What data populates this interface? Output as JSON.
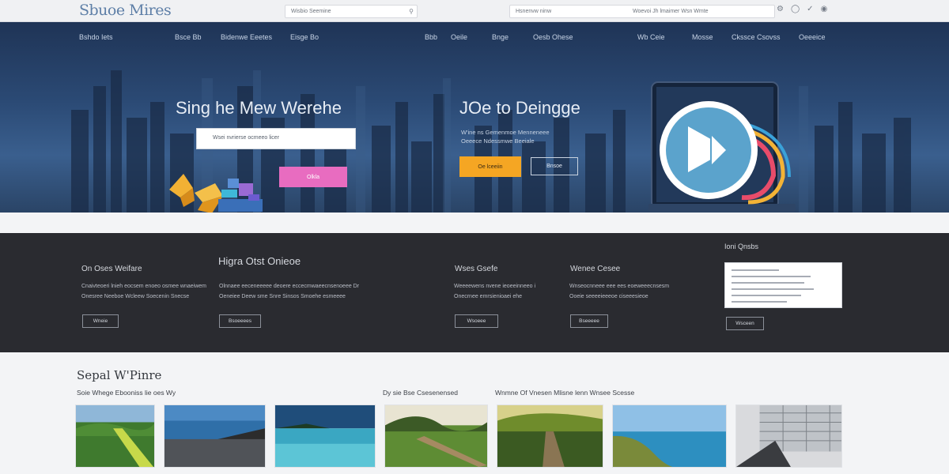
{
  "header": {
    "logo": "Sbuoe Mires",
    "search_left": {
      "placeholder": "Wisbio Seemine"
    },
    "search_right": {
      "placeholder_left": "Hsnenvw ninw",
      "placeholder_right": "Woevoi Jh lmaimer Wsn Wmte"
    },
    "icons": [
      "settings-icon",
      "user-icon",
      "cart-icon",
      "globe-icon"
    ]
  },
  "nav": {
    "items": [
      "Bshdo Iets",
      "Bsce Bb",
      "Bidenwe Eeetes",
      "Eisge Bo",
      "Bbb",
      "Oeile",
      "Bnge",
      "Oesb Ohese",
      "Wb Ceie",
      "Mosse",
      "Ckssce Csovss",
      "Oeeeice"
    ]
  },
  "hero": {
    "left_title": "Sing he Mew Werehe",
    "input_placeholder": "Wsei nvrierse ocmeeo licer",
    "pink_button": "Olkla",
    "right_title": "JOe to Deingge",
    "right_subtitle_1": "W'ine ns Gemenmoe Menneneee",
    "right_subtitle_2": "Oeeece Ndessmwe Beeiale",
    "orange_button": "Oe lceeiin",
    "outline_button": "Bnsoe"
  },
  "features": {
    "col1": {
      "title": "On Oses Weifare",
      "line1": "Cnaivteoeri lnieh eocsem enoeo osmee wnaeiwem",
      "line2": "Onesree Neeboe Wcleew Soecenin Snecse",
      "button": "Wneie"
    },
    "col2": {
      "title": "Higra Otst Onieoe",
      "line1": "Olnnaee eeceneeeee deoere eccecmwaeecnsenoeee Dr",
      "line2": "Oeneiee Deew sme Snre Sinsos Smoehe esmeeee",
      "button": "Bsoeeees"
    },
    "col3": {
      "title": "Wses Gsefe",
      "line1": "Weeeewens nvene ieoeeinneeo i",
      "line2": "Onecrnee emrsienioaei ehe",
      "button": "Wsoeee"
    },
    "col4": {
      "title": "Wenee Cesee",
      "line1": "Wnseocnneee eee ees eoeweeecnsesm",
      "line2": "Ooeie seeeeieeeoe ciseeesieoe",
      "button": "Bseeeee"
    },
    "col5": {
      "title": "Ioni Qnsbs",
      "button": "Wsceen"
    }
  },
  "gallery": {
    "title": "Sepal W'Pinre",
    "subtitle_left": "Soie Whege Ebooniss lie oes Wy",
    "subtitle_mid": "Dy sie Bse Csesenensed",
    "subtitle_right": "Wnmne Of Vnesen Mlisne lenn Wnsee Scesse"
  }
}
